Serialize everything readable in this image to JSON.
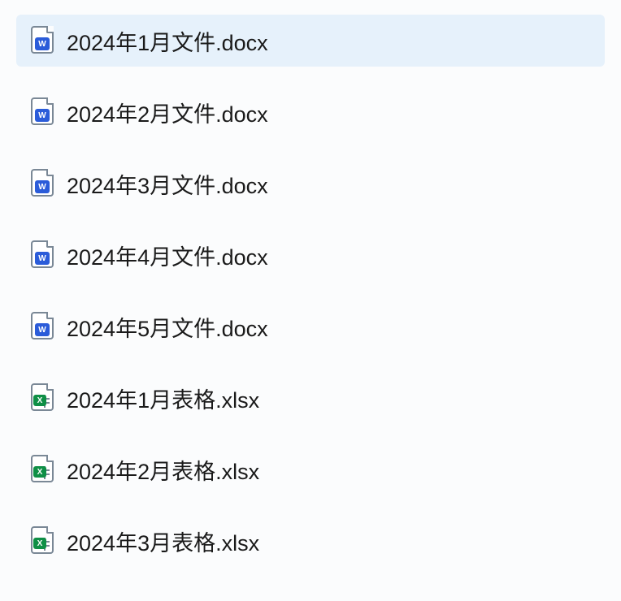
{
  "files": [
    {
      "name": "2024年1月文件.docx",
      "type": "docx",
      "selected": true
    },
    {
      "name": "2024年2月文件.docx",
      "type": "docx",
      "selected": false
    },
    {
      "name": "2024年3月文件.docx",
      "type": "docx",
      "selected": false
    },
    {
      "name": "2024年4月文件.docx",
      "type": "docx",
      "selected": false
    },
    {
      "name": "2024年5月文件.docx",
      "type": "docx",
      "selected": false
    },
    {
      "name": "2024年1月表格.xlsx",
      "type": "xlsx",
      "selected": false
    },
    {
      "name": "2024年2月表格.xlsx",
      "type": "xlsx",
      "selected": false
    },
    {
      "name": "2024年3月表格.xlsx",
      "type": "xlsx",
      "selected": false
    }
  ]
}
